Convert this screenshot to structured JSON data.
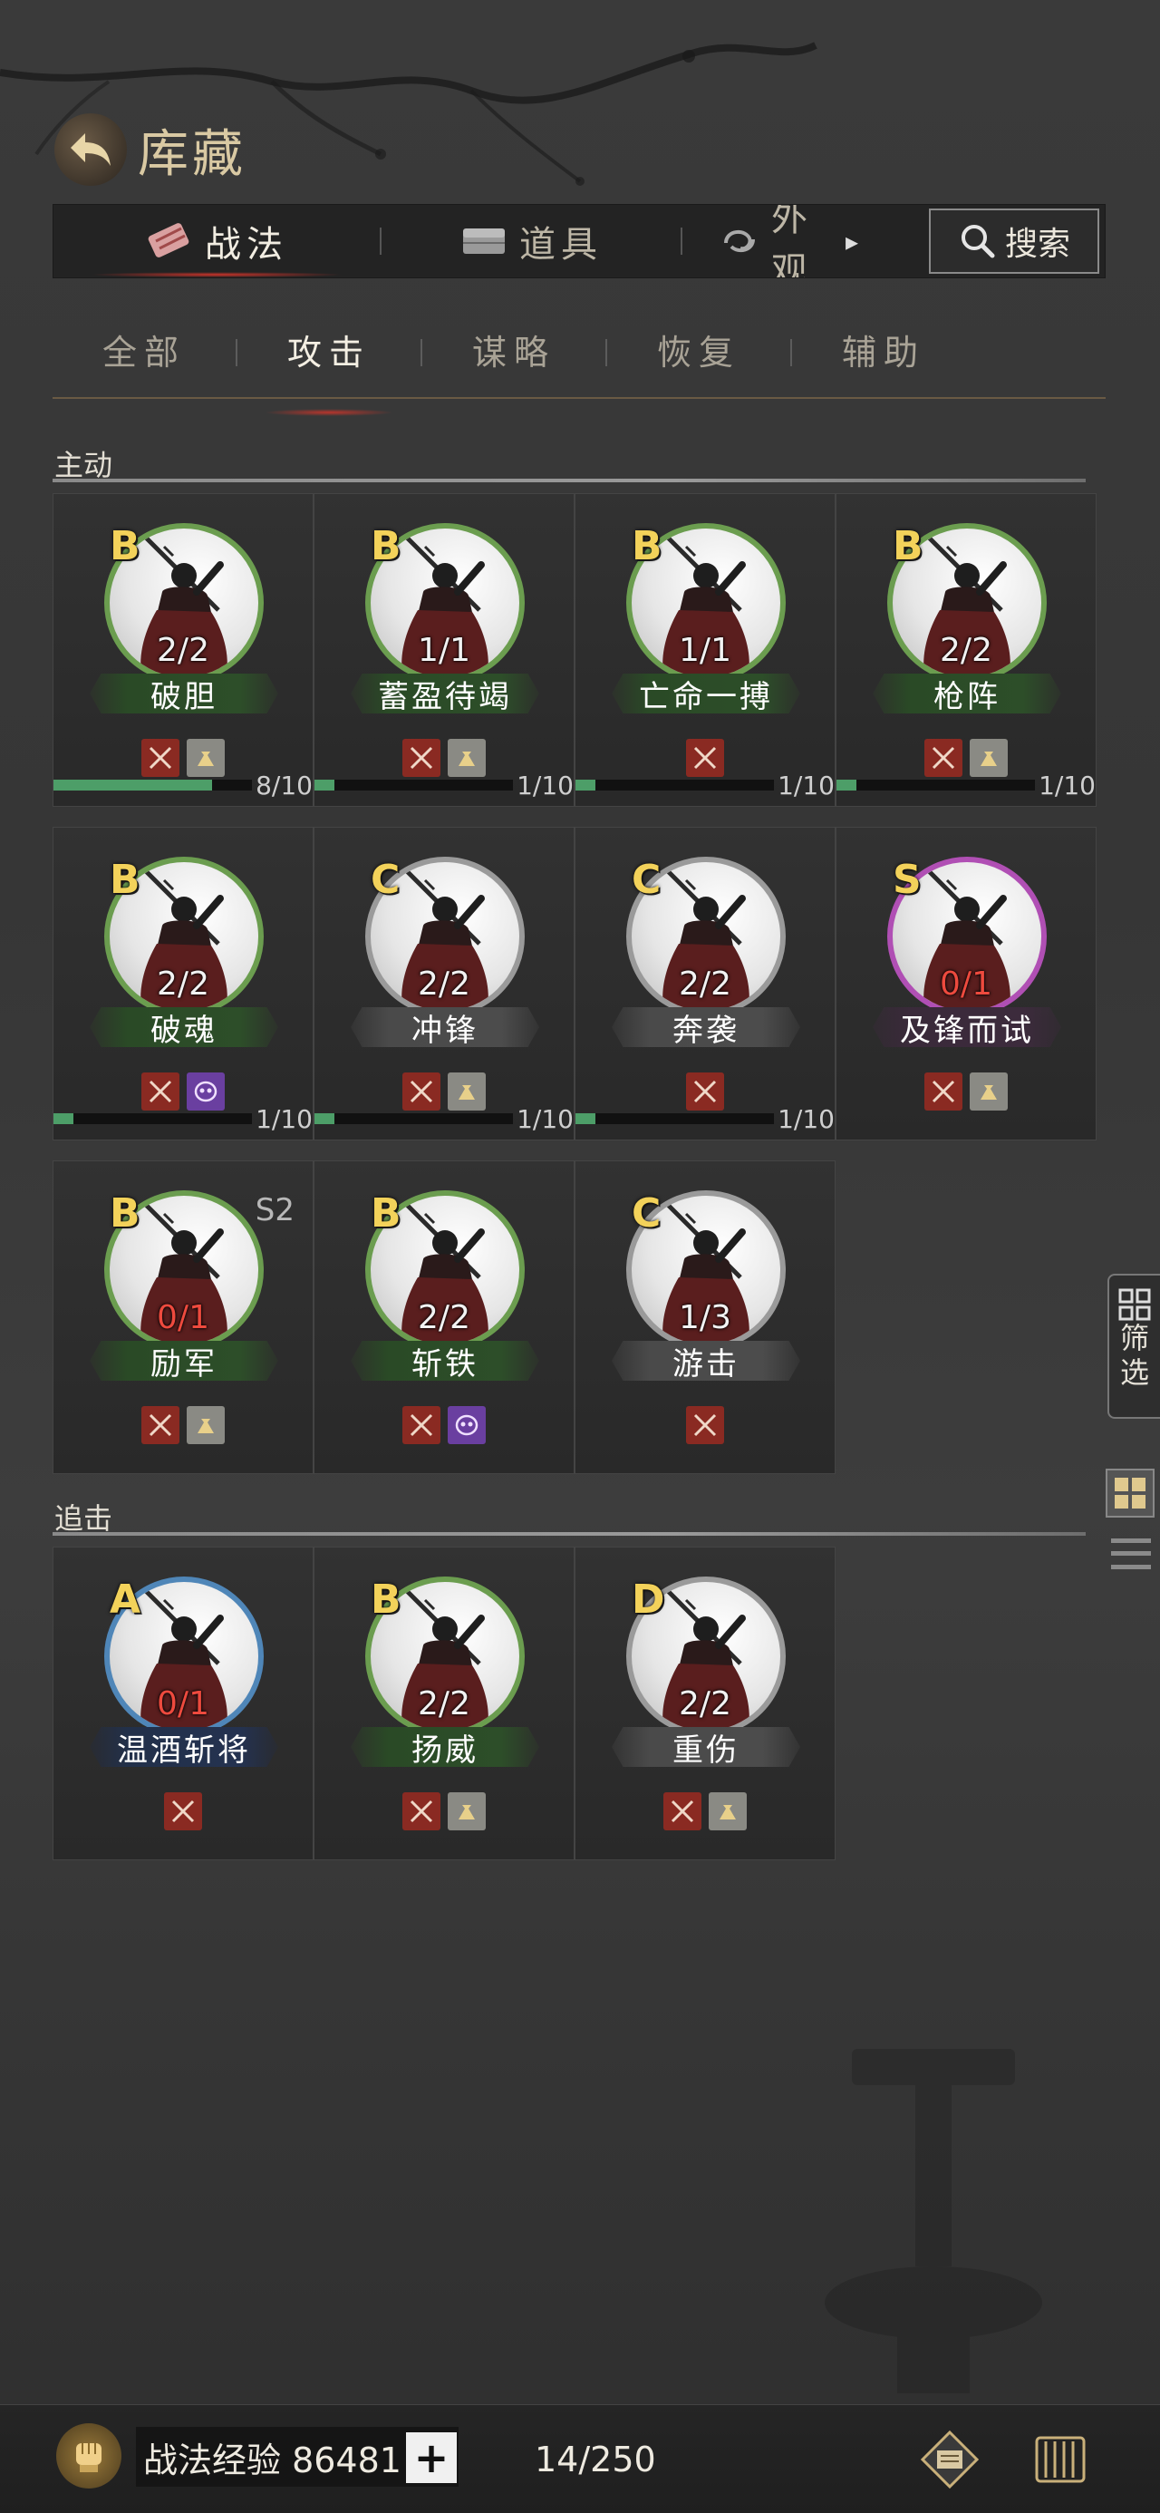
{
  "header": {
    "title": "库藏"
  },
  "top_tabs": [
    {
      "label": "战法",
      "icon": "scroll-icon",
      "active": true
    },
    {
      "label": "道具",
      "icon": "chest-icon",
      "active": false
    },
    {
      "label": "外观",
      "icon": "swirl-icon",
      "active": false
    }
  ],
  "search": {
    "label": "搜索"
  },
  "sub_tabs": [
    {
      "label": "全部",
      "active": false
    },
    {
      "label": "攻击",
      "active": true
    },
    {
      "label": "谋略",
      "active": false
    },
    {
      "label": "恢复",
      "active": false
    },
    {
      "label": "辅助",
      "active": false
    }
  ],
  "sections": [
    {
      "title": "主动",
      "cards": [
        {
          "grade": "B",
          "count": "2/2",
          "name": "破胆",
          "plate": "green",
          "icons": [
            "sword",
            "bag"
          ],
          "progress": {
            "text": "8/10",
            "value": 0.8
          }
        },
        {
          "grade": "B",
          "count": "1/1",
          "name": "蓄盈待竭",
          "plate": "green",
          "icons": [
            "sword",
            "bag"
          ],
          "progress": {
            "text": "1/10",
            "value": 0.1
          }
        },
        {
          "grade": "B",
          "count": "1/1",
          "name": "亡命一搏",
          "plate": "green",
          "icons": [
            "sword"
          ],
          "progress": {
            "text": "1/10",
            "value": 0.1
          }
        },
        {
          "grade": "B",
          "count": "2/2",
          "name": "枪阵",
          "plate": "green",
          "icons": [
            "sword",
            "bag"
          ],
          "progress": {
            "text": "1/10",
            "value": 0.1
          }
        },
        {
          "grade": "B",
          "count": "2/2",
          "name": "破魂",
          "plate": "green",
          "icons": [
            "sword",
            "mask"
          ],
          "progress": {
            "text": "1/10",
            "value": 0.1
          }
        },
        {
          "grade": "C",
          "count": "2/2",
          "name": "冲锋",
          "plate": "gray",
          "icons": [
            "sword",
            "bag"
          ],
          "progress": {
            "text": "1/10",
            "value": 0.1
          }
        },
        {
          "grade": "C",
          "count": "2/2",
          "name": "奔袭",
          "plate": "gray",
          "icons": [
            "sword"
          ],
          "progress": {
            "text": "1/10",
            "value": 0.1
          }
        },
        {
          "grade": "S",
          "count": "0/1",
          "name": "及锋而试",
          "plate": "purple",
          "icons": [
            "sword",
            "bag"
          ],
          "progress": null
        },
        {
          "grade": "B",
          "count": "0/1",
          "name": "励军",
          "plate": "green",
          "icons": [
            "sword",
            "bag"
          ],
          "progress": null,
          "season": "S2"
        },
        {
          "grade": "B",
          "count": "2/2",
          "name": "斩铁",
          "plate": "green",
          "icons": [
            "sword",
            "mask"
          ],
          "progress": null
        },
        {
          "grade": "C",
          "count": "1/3",
          "name": "游击",
          "plate": "gray",
          "icons": [
            "sword"
          ],
          "progress": null
        }
      ]
    },
    {
      "title": "追击",
      "cards": [
        {
          "grade": "A",
          "count": "0/1",
          "name": "温酒斩将",
          "plate": "blue",
          "icons": [
            "sword"
          ],
          "progress": null
        },
        {
          "grade": "B",
          "count": "2/2",
          "name": "扬威",
          "plate": "green",
          "icons": [
            "sword",
            "bag"
          ],
          "progress": null
        },
        {
          "grade": "D",
          "count": "2/2",
          "name": "重伤",
          "plate": "gray",
          "icons": [
            "sword",
            "bag"
          ],
          "progress": null
        }
      ]
    }
  ],
  "side": {
    "filter_label_1": "筛",
    "filter_label_2": "选"
  },
  "bottom": {
    "exp_label": "战法经验 86481",
    "plus": "+",
    "capacity": "14/250"
  },
  "colors": {
    "grade_text": "#f3d25a",
    "progress_fill": "#4d9e68",
    "zero_count": "#ee4a3e",
    "sword_icon_bg": "#8a2a22",
    "bag_icon_bg": "#8a8a84",
    "mask_icon_bg": "#6a3fa0"
  }
}
